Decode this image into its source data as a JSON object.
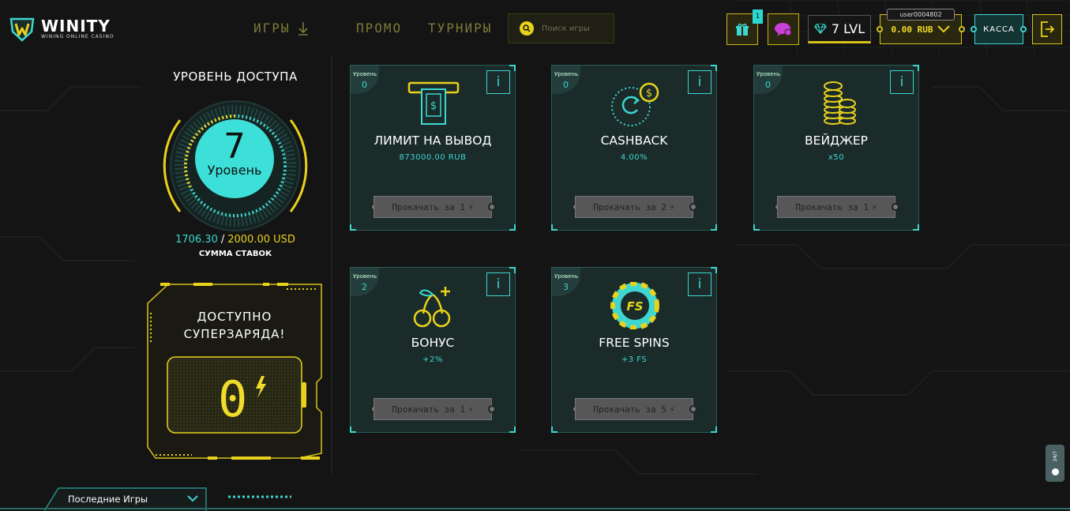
{
  "header": {
    "brand": "WINITY",
    "tagline": "WINING ONLINE CASINO",
    "nav": {
      "games": "ИГРЫ",
      "promo": "ПРОМО",
      "tournaments": "ТУРНИРЫ"
    },
    "search_placeholder": "Поиск игры",
    "gift_count": "1",
    "level": "7 LVL",
    "username": "user0004802",
    "balance": "0.00 RUB",
    "cashier": "КАССА"
  },
  "access": {
    "title": "УРОВЕНЬ ДОСТУПА",
    "level_number": "7",
    "level_word": "Уровень",
    "stakes_current": "1706.30",
    "stakes_separator": "/",
    "stakes_target": "2000.00 USD",
    "stakes_label": "СУММА СТАВОК"
  },
  "supercharge": {
    "title_line1": "ДОСТУПНО",
    "title_line2": "СУПЕРЗАРЯДА!",
    "count": "0"
  },
  "level_label": "Уровень",
  "cards": [
    {
      "level": "0",
      "title": "ЛИМИТ НА ВЫВОД",
      "value": "873000.00 RUB",
      "upgrade": "Прокачать за 1",
      "icon": "atm-cash-icon"
    },
    {
      "level": "0",
      "title": "CASHBACK",
      "value": "4.00%",
      "upgrade": "Прокачать за 2",
      "icon": "cashback-coin-icon"
    },
    {
      "level": "0",
      "title": "ВЕЙДЖЕР",
      "value": "x50",
      "upgrade": "Прокачать за 1",
      "icon": "coin-stack-icon"
    },
    {
      "level": "2",
      "title": "БОНУС",
      "value": "+2%",
      "upgrade": "Прокачать за 1",
      "icon": "cherry-icon"
    },
    {
      "level": "3",
      "title": "FREE SPINS",
      "value": "+3 FS",
      "upgrade": "Прокачать за 5",
      "icon": "fs-chip-icon"
    }
  ],
  "info_symbol": "i",
  "recent_games": "Последние Игры",
  "support_label": "24/7",
  "colors": {
    "accent_yellow": "#e8d21c",
    "accent_cyan": "#3dd6d0",
    "background": "#141414"
  }
}
